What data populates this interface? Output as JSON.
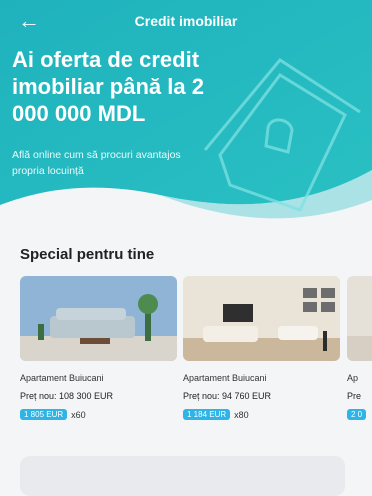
{
  "header": {
    "title": "Credit imobiliar",
    "back_icon": "arrow-left-icon"
  },
  "hero": {
    "headline": "Ai oferta de credit imobiliar până la 2 000 000 MDL",
    "subtitle": "Află online cum să procuri avantajos propria locuință",
    "illustration_icon": "house-icon",
    "colors": {
      "teal": "#1fb2bd",
      "teal_light": "#5fd0d6"
    }
  },
  "section": {
    "title": "Special pentru tine"
  },
  "offers": [
    {
      "name": "Apartament Buiucani",
      "price": "Preț nou: 108 300 EUR",
      "monthly": "1 805 EUR",
      "months": "x60"
    },
    {
      "name": "Apartament Buiucani",
      "price": "Preț nou: 94 760 EUR",
      "monthly": "1 184 EUR",
      "months": "x80"
    },
    {
      "name": "Ap",
      "price": "Pre",
      "monthly": "2 0",
      "months": ""
    }
  ],
  "colors": {
    "badge": "#2fb4e8"
  }
}
